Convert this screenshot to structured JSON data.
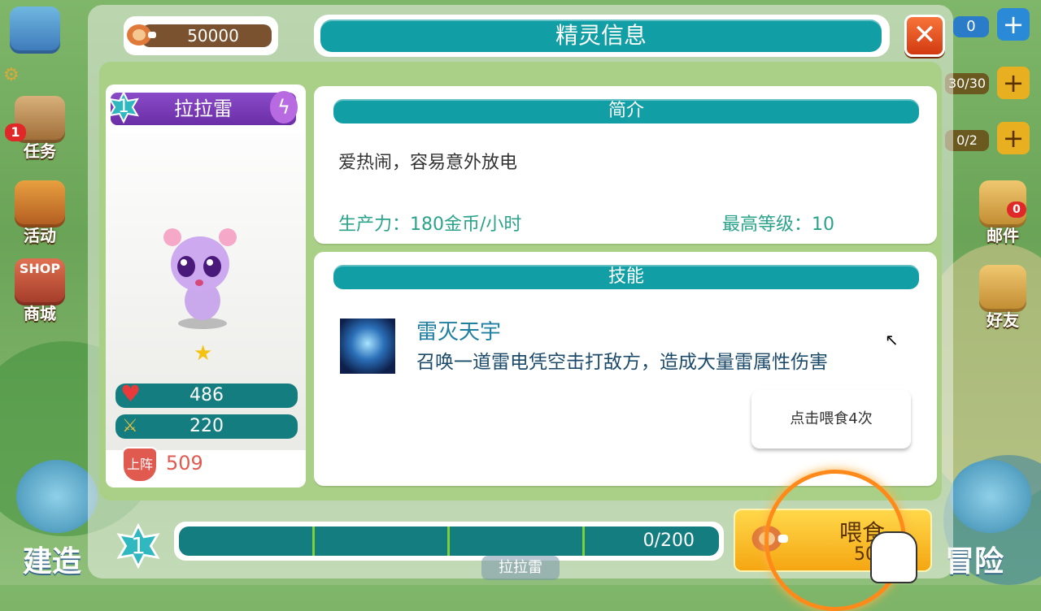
{
  "header": {
    "title": "精灵信息"
  },
  "currency": {
    "amount": "50000"
  },
  "side_left": [
    {
      "label": "任务",
      "badge": "1"
    },
    {
      "label": "活动"
    },
    {
      "label": "商城",
      "banner": "SHOP"
    }
  ],
  "side_right": {
    "mail_label": "邮件",
    "mail_badge": "0",
    "friends_label": "好友",
    "res1": "30/30",
    "res2": "0/2",
    "res_top": "0"
  },
  "bottom_corners": {
    "build": "建造",
    "adventure": "冒险"
  },
  "spirit": {
    "level": "1",
    "name": "拉拉雷",
    "stars": 1,
    "hp": "486",
    "attack": "220",
    "deploy_label": "上阵",
    "power": "509"
  },
  "intro": {
    "title": "简介",
    "description": "爱热闹，容易意外放电",
    "production": "生产力：180金币/小时",
    "max_level": "最高等级：10"
  },
  "skills": {
    "title": "技能",
    "skill_name": "雷灭天宇",
    "skill_desc": "召唤一道雷电凭空击打敌方，造成大量雷属性伤害",
    "feed_tip": "点击喂食4次"
  },
  "exp": {
    "level": "1",
    "text": "0/200",
    "progress": 0
  },
  "feed_button": {
    "label": "喂食",
    "cost": "50"
  },
  "bottom_tab": {
    "label": "拉拉雷"
  },
  "colors": {
    "teal": "#119fa5",
    "purple": "#7a3cba",
    "gold": "#f5b21e",
    "red": "#e0502a"
  }
}
